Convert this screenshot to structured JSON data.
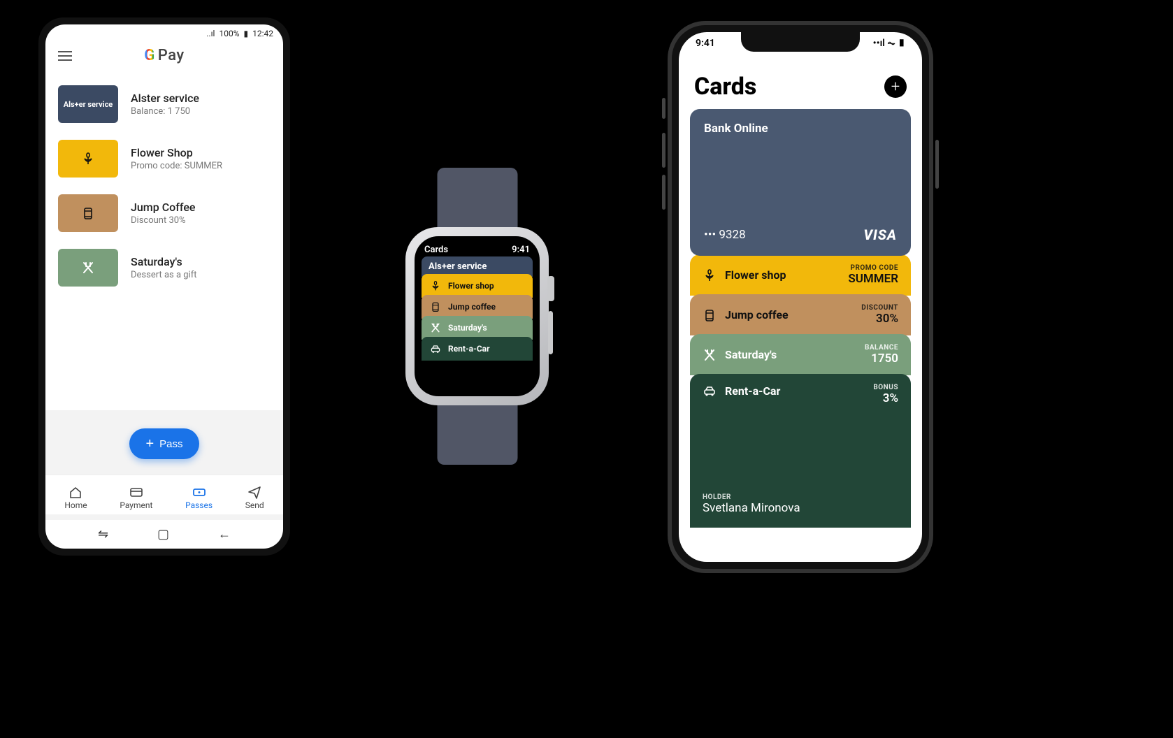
{
  "android": {
    "status": {
      "signal": "📶",
      "battery_pct": "100%",
      "time": "12:42"
    },
    "app_title": "Pay",
    "passes": [
      {
        "name": "Alster service",
        "sub": "Balance: 1 750",
        "thumb_label": "Als+er service"
      },
      {
        "name": "Flower Shop",
        "sub": "Promo code: SUMMER",
        "icon": "flower"
      },
      {
        "name": "Jump Coffee",
        "sub": "Discount 30%",
        "icon": "coffee"
      },
      {
        "name": "Saturday's",
        "sub": "Dessert as a gift",
        "icon": "utensils"
      }
    ],
    "fab_label": "Pass",
    "nav": {
      "home": "Home",
      "payment": "Payment",
      "passes": "Passes",
      "send": "Send"
    }
  },
  "watch": {
    "title": "Cards",
    "time": "9:41",
    "rows": [
      {
        "label": "Als+er service"
      },
      {
        "label": "Flower shop"
      },
      {
        "label": "Jump coffee"
      },
      {
        "label": "Saturday's"
      },
      {
        "label": "Rent-a-Car"
      }
    ]
  },
  "iphone": {
    "status_time": "9:41",
    "title": "Cards",
    "bank_card": {
      "name": "Bank Online",
      "last4_text": "••• 9328",
      "network": "VISA"
    },
    "wallet": [
      {
        "label": "Flower shop",
        "meta_label": "PROMO CODE",
        "meta_value": "SUMMER"
      },
      {
        "label": "Jump coffee",
        "meta_label": "DISCOUNT",
        "meta_value": "30%"
      },
      {
        "label": "Saturday's",
        "meta_label": "BALANCE",
        "meta_value": "1750"
      },
      {
        "label": "Rent-a-Car",
        "meta_label": "BONUS",
        "meta_value": "3%"
      }
    ],
    "holder_label": "HOLDER",
    "holder_name": "Svetlana Mironova"
  }
}
